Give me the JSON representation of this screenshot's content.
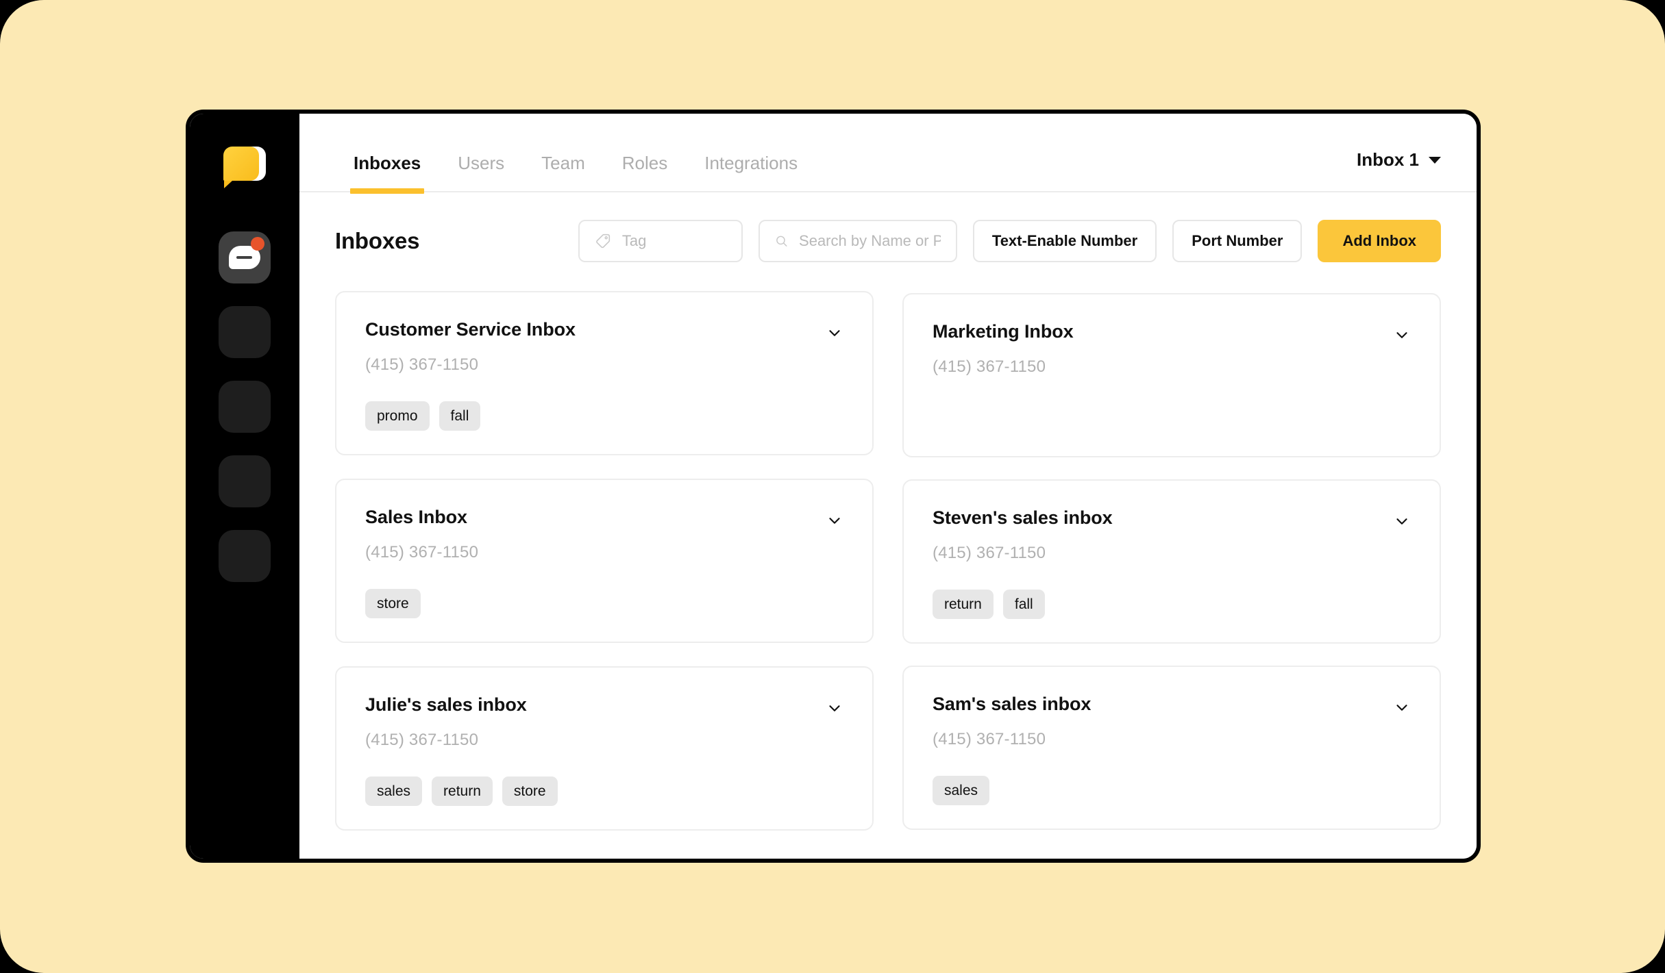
{
  "sidebar": {
    "logo_icon": "speech-bubble-logo",
    "items": [
      {
        "icon": "message-icon",
        "active": true,
        "badge": true
      },
      {
        "icon": "placeholder-icon",
        "active": false,
        "badge": false
      },
      {
        "icon": "placeholder-icon",
        "active": false,
        "badge": false
      },
      {
        "icon": "placeholder-icon",
        "active": false,
        "badge": false
      },
      {
        "icon": "placeholder-icon",
        "active": false,
        "badge": false
      }
    ]
  },
  "topnav": {
    "tabs": [
      {
        "label": "Inboxes",
        "active": true
      },
      {
        "label": "Users",
        "active": false
      },
      {
        "label": "Team",
        "active": false
      },
      {
        "label": "Roles",
        "active": false
      },
      {
        "label": "Integrations",
        "active": false
      }
    ],
    "inbox_selector": {
      "label": "Inbox 1",
      "caret_icon": "caret-down-icon"
    }
  },
  "toolbar": {
    "title": "Inboxes",
    "tag_filter": {
      "icon": "tag-icon",
      "value": "",
      "placeholder": "Tag"
    },
    "search": {
      "icon": "search-icon",
      "value": "",
      "placeholder": "Search by Name or Phone"
    },
    "text_enable_label": "Text-Enable Number",
    "port_number_label": "Port Number",
    "add_inbox_label": "Add Inbox"
  },
  "colors": {
    "brand_yellow": "#FBC63B",
    "tab_underline": "#FBC02D",
    "canvas_cream": "#FCE9B4",
    "rail_black": "#000000",
    "rail_active": "#404040",
    "badge_red": "#E8542B",
    "tag_chip": "#e7e7e7",
    "muted_text": "#b0b0b0"
  },
  "cards": {
    "left": [
      {
        "title": "Customer Service Inbox",
        "phone": "(415) 367-1150",
        "chevron_icon": "chevron-down-icon",
        "tags": [
          "promo",
          "fall"
        ]
      },
      {
        "title": "Sales Inbox",
        "phone": "(415) 367-1150",
        "chevron_icon": "chevron-down-icon",
        "tags": [
          "store"
        ]
      },
      {
        "title": "Julie's sales inbox",
        "phone": "(415) 367-1150",
        "chevron_icon": "chevron-down-icon",
        "tags": [
          "sales",
          "return",
          "store"
        ]
      }
    ],
    "right": [
      {
        "title": "Marketing Inbox",
        "phone": "(415) 367-1150",
        "chevron_icon": "chevron-down-icon",
        "tags": []
      },
      {
        "title": "Steven's sales inbox",
        "phone": "(415) 367-1150",
        "chevron_icon": "chevron-down-icon",
        "tags": [
          "return",
          "fall"
        ]
      },
      {
        "title": "Sam's sales inbox",
        "phone": "(415) 367-1150",
        "chevron_icon": "chevron-down-icon",
        "tags": [
          "sales"
        ]
      }
    ]
  }
}
